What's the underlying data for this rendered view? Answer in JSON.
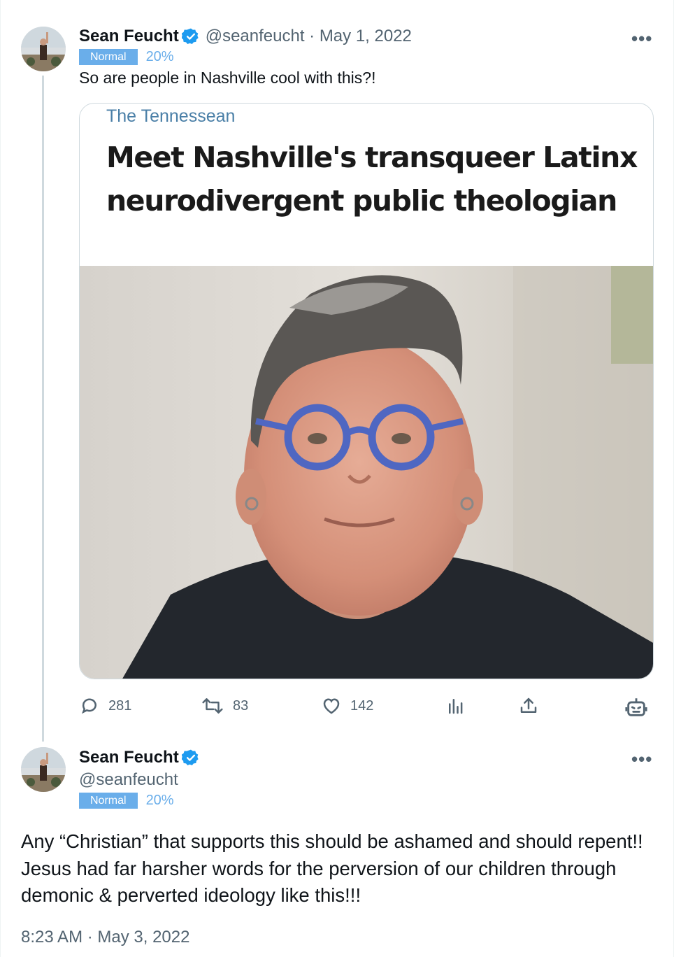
{
  "tweet1": {
    "display_name": "Sean Feucht",
    "handle_date": "@seanfeucht · May 1, 2022",
    "tag_label": "Normal",
    "tag_pct": "20%",
    "text": "So are people in Nashville cool with this?!",
    "more_label": "•••"
  },
  "card": {
    "publication": "The Tennessean",
    "headline": "Meet Nashville's transqueer Latinx neurodivergent public theologian"
  },
  "actions": {
    "replies": "281",
    "retweets": "83",
    "likes": "142"
  },
  "icons": [
    "reply-icon",
    "retweet-icon",
    "like-icon",
    "views-icon",
    "share-icon",
    "bot-icon",
    "verified-icon",
    "more-icon"
  ],
  "tweet2": {
    "display_name": "Sean Feucht",
    "handle": "@seanfeucht",
    "tag_label": "Normal",
    "tag_pct": "20%",
    "text": "Any “Christian” that supports this should be ashamed and should repent!! Jesus had far harsher words for the perversion of our children through demonic & perverted ideology like this!!!",
    "timestamp": "8:23 AM · May 3, 2022",
    "more_label": "•••"
  },
  "colors": {
    "verified": "#1d9bf0",
    "tag_bg": "#6aaeea",
    "secondary_text": "#536471",
    "publication": "#4a7fa7"
  }
}
